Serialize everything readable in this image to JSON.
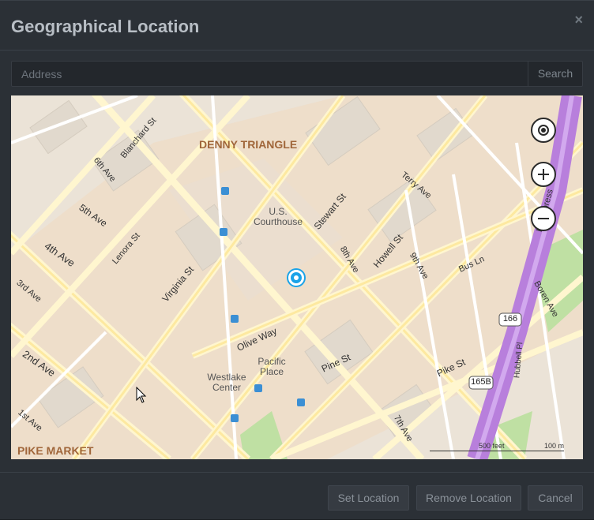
{
  "dialog": {
    "title": "Geographical Location",
    "close_label": "×"
  },
  "search": {
    "placeholder": "Address",
    "value": "",
    "button_label": "Search"
  },
  "map": {
    "area_labels": [
      "DENNY TRIANGLE",
      "PIKE MARKET"
    ],
    "place_labels": [
      "U.S. Courthouse",
      "Pacific Place",
      "Westlake Center"
    ],
    "street_labels": [
      "5th Ave",
      "4th Ave",
      "2nd Ave",
      "Virginia St",
      "Stewart St",
      "Olive Way",
      "Pine St",
      "Howell St",
      "Terry Ave",
      "Boren Ave",
      "Pike St",
      "8th Ave",
      "9th Ave",
      "7th Ave",
      "6th Ave",
      "3rd Ave",
      "Lenora St",
      "Blanchard St",
      "Bus Ln",
      "1st Ave",
      "Hubbell Pl",
      "I-5 Express"
    ],
    "highway_shields": [
      "166",
      "165B"
    ],
    "scale": {
      "feet": "500 feet",
      "meters": "100 m"
    },
    "controls": [
      "locate-me",
      "zoom-in",
      "zoom-out"
    ]
  },
  "footer": {
    "set_location": "Set Location",
    "remove_location": "Remove Location",
    "cancel": "Cancel"
  },
  "colors": {
    "dialog_bg": "#2b3036",
    "map_land": "#ebe3d7",
    "road": "#fff6cf",
    "highway": "#b87fdc",
    "park": "#bfe0a3",
    "marker": "#1aa3e8"
  }
}
